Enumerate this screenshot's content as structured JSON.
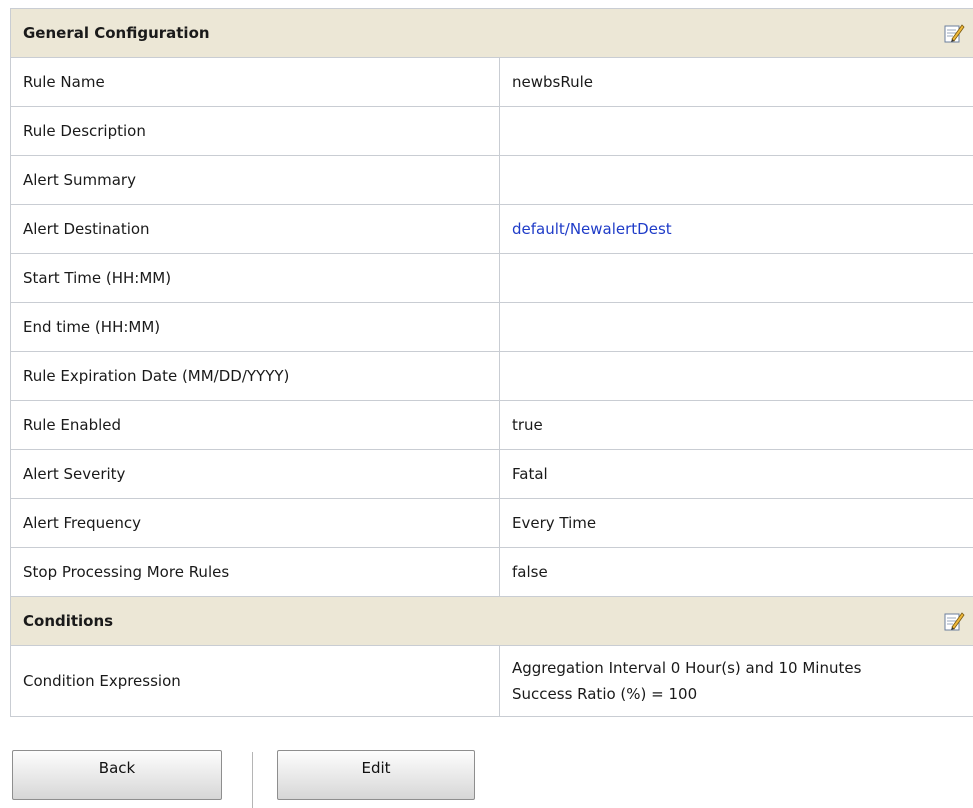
{
  "general": {
    "title": "General Configuration",
    "edit_icon": "edit-pencil-icon",
    "rows": [
      {
        "label": "Rule Name",
        "value": "newbsRule"
      },
      {
        "label": "Rule Description",
        "value": ""
      },
      {
        "label": "Alert Summary",
        "value": ""
      },
      {
        "label": "Alert Destination",
        "value": "default/NewalertDest"
      },
      {
        "label": "Start Time (HH:MM)",
        "value": ""
      },
      {
        "label": "End time (HH:MM)",
        "value": ""
      },
      {
        "label": "Rule Expiration Date (MM/DD/YYYY)",
        "value": ""
      },
      {
        "label": "Rule Enabled",
        "value": "true"
      },
      {
        "label": "Alert Severity",
        "value": "Fatal"
      },
      {
        "label": "Alert Frequency",
        "value": "Every Time"
      },
      {
        "label": "Stop Processing More Rules",
        "value": "false"
      }
    ]
  },
  "conditions": {
    "title": "Conditions",
    "edit_icon": "edit-pencil-icon",
    "rows": [
      {
        "label": "Condition Expression",
        "value_line1": "Aggregation Interval 0 Hour(s) and 10 Minutes",
        "value_line2": "Success Ratio (%) = 100"
      }
    ]
  },
  "buttons": {
    "back_label": "Back",
    "edit_label": "Edit"
  },
  "colors": {
    "header_bg": "#ece7d6",
    "border": "#c9cdd3",
    "link": "#1f3cc8"
  }
}
